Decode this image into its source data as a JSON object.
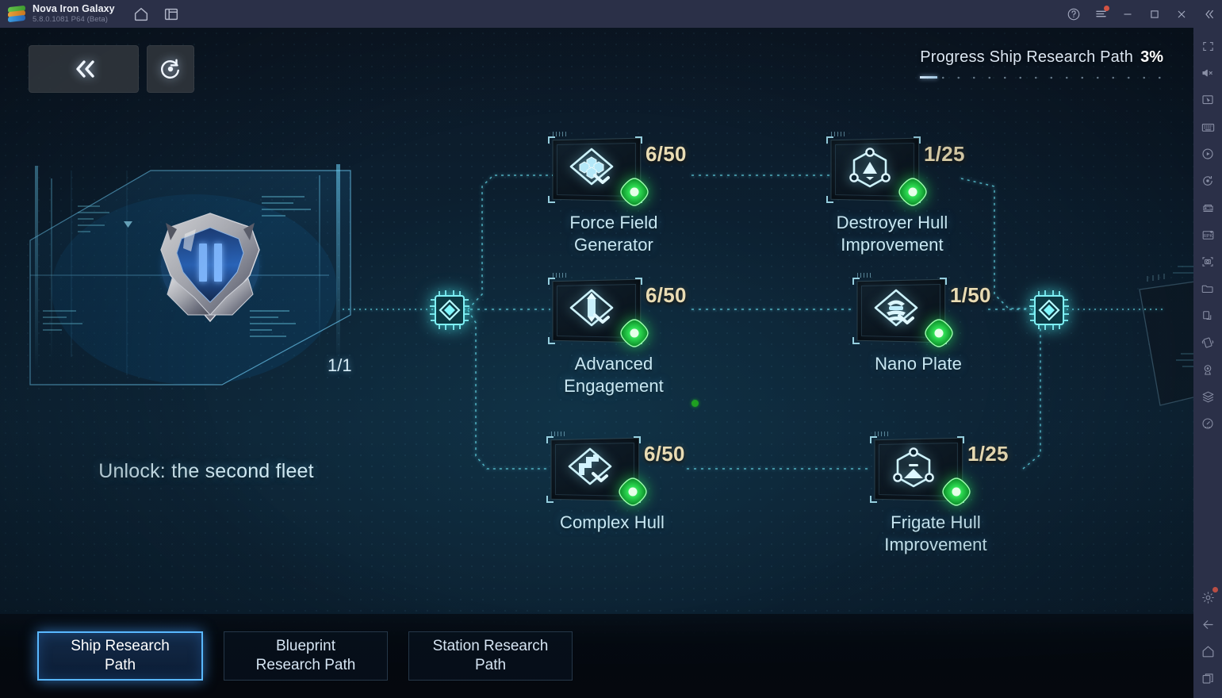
{
  "emulator": {
    "app_name": "Nova Iron Galaxy",
    "version": "5.8.0.1081 P64 (Beta)",
    "titlebar_icons": [
      "home-icon",
      "multi-window-icon"
    ],
    "window_controls": [
      "help-icon",
      "menu-icon",
      "minimize-icon",
      "maximize-icon",
      "close-icon",
      "collapse-sidebar-icon"
    ],
    "sidebar_icons": [
      "fullscreen-icon",
      "volume-mute-icon",
      "pointer-icon",
      "keyboard-icon",
      "macro-play-icon",
      "sync-rotate-icon",
      "gamepad-icon",
      "rpk-icon",
      "screenshot-icon",
      "folder-icon",
      "multi-window-icon",
      "shake-icon",
      "location-icon",
      "multi-instance-icon",
      "speedometer-icon"
    ],
    "sidebar_bottom_icons": [
      "settings-gear-icon",
      "back-arrow-icon",
      "home-icon",
      "recents-icon"
    ]
  },
  "topbar": {
    "back_button": "collapse-left-icon",
    "refresh_button": "refresh-icon"
  },
  "progress": {
    "label": "Progress Ship Research Path",
    "percent": "3%",
    "percent_value": 3
  },
  "fleet": {
    "label": "Unlock: the second fleet",
    "count": "1/1",
    "emblem_numeral": "II"
  },
  "nodes": [
    {
      "id": "force-field-generator",
      "name": "Force Field\nGenerator",
      "name_lines": [
        "Force Field",
        "Generator"
      ],
      "count": "6/50",
      "current": 6,
      "max": 50,
      "glyph": "hexagon-cluster-diamond-icon",
      "gem": "green-gem-icon"
    },
    {
      "id": "destroyer-hull-improvement",
      "name": "Destroyer Hull\nImprovement",
      "name_lines": [
        "Destroyer Hull",
        "Improvement"
      ],
      "count": "1/25",
      "current": 1,
      "max": 25,
      "glyph": "hexagon-node-triangle-icon",
      "gem": "green-gem-icon"
    },
    {
      "id": "advanced-engagement",
      "name": "Advanced\nEngagement",
      "name_lines": [
        "Advanced",
        "Engagement"
      ],
      "count": "6/50",
      "current": 6,
      "max": 50,
      "glyph": "diamond-missile-icon",
      "gem": "green-gem-icon"
    },
    {
      "id": "nano-plate",
      "name": "Nano Plate",
      "name_lines": [
        "Nano Plate"
      ],
      "count": "1/50",
      "current": 1,
      "max": 50,
      "glyph": "diamond-layered-plate-icon",
      "gem": "green-gem-icon"
    },
    {
      "id": "complex-hull",
      "name": "Complex Hull",
      "name_lines": [
        "Complex Hull"
      ],
      "count": "6/50",
      "current": 6,
      "max": 50,
      "glyph": "diamond-zigzag-icon",
      "gem": "green-gem-icon"
    },
    {
      "id": "frigate-hull-improvement",
      "name": "Frigate Hull\nImprovement",
      "name_lines": [
        "Frigate Hull",
        "Improvement"
      ],
      "count": "1/25",
      "current": 1,
      "max": 25,
      "glyph": "hexagon-node-arrow-icon",
      "gem": "green-gem-icon"
    }
  ],
  "hubs": [
    {
      "id": "hub-left",
      "icon": "chip-node-icon"
    },
    {
      "id": "hub-right",
      "icon": "chip-node-icon"
    }
  ],
  "tabs": [
    {
      "id": "ship-research-path",
      "lines": [
        "Ship Research",
        "Path"
      ],
      "active": true
    },
    {
      "id": "blueprint-research-path",
      "lines": [
        "Blueprint",
        "Research Path"
      ],
      "active": false
    },
    {
      "id": "station-research-path",
      "lines": [
        "Station Research",
        "Path"
      ],
      "active": false
    }
  ],
  "colors": {
    "accent_cyan": "#7fe3f0",
    "gem_green": "#22c34a",
    "count_gold": "#e9dcb4",
    "tab_active_border": "#59b8ff",
    "chrome_bg": "#2b3048",
    "notify_red": "#f25a43"
  }
}
